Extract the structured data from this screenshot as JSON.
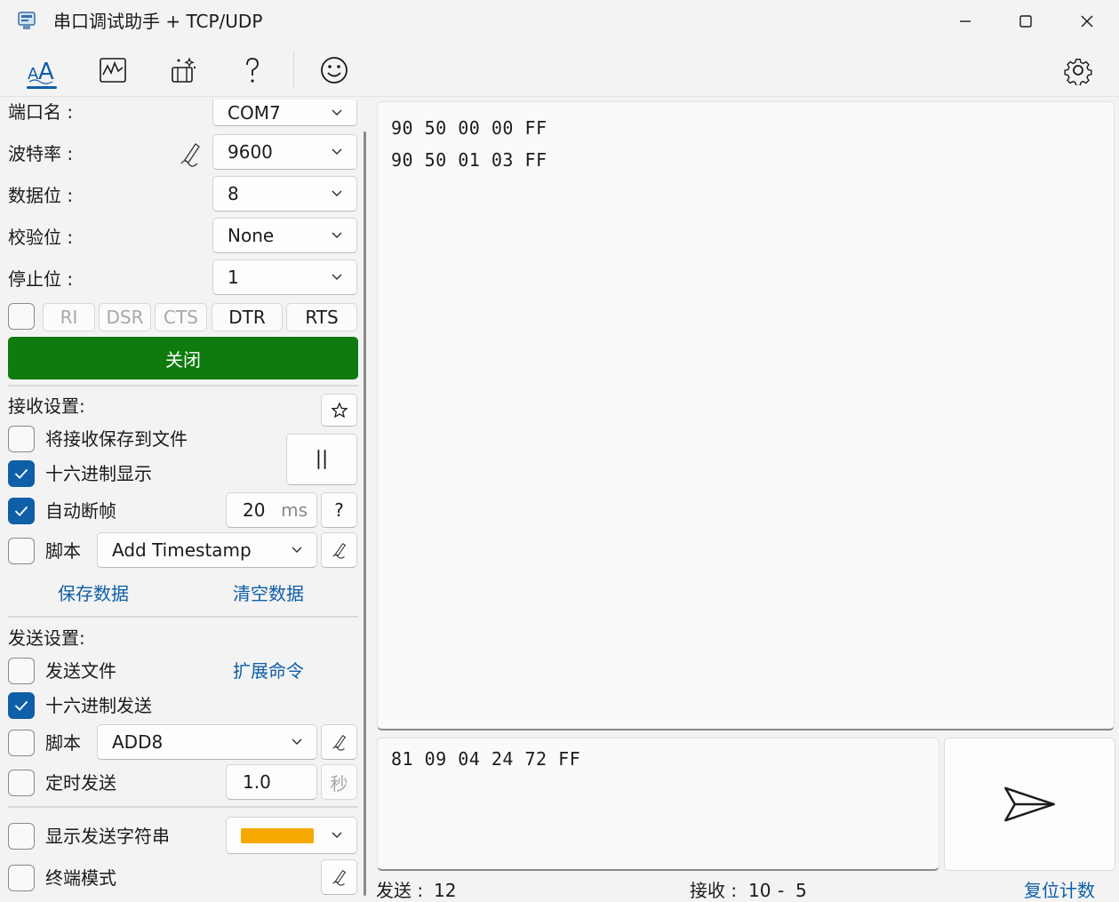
{
  "window": {
    "title": "串口调试助手 + TCP/UDP"
  },
  "toolbar": {
    "icons": [
      "text-format-icon",
      "waveform-icon",
      "magic-icon",
      "help-icon",
      "smiley-icon",
      "gear-icon"
    ]
  },
  "serial": {
    "port_label": "端口名 :",
    "port_value": "COM7",
    "baud_label": "波特率 :",
    "baud_value": "9600",
    "databits_label": "数据位 :",
    "databits_value": "8",
    "parity_label": "校验位 :",
    "parity_value": "None",
    "stopbits_label": "停止位 :",
    "stopbits_value": "1",
    "signals": {
      "ri": "RI",
      "dsr": "DSR",
      "cts": "CTS",
      "dtr": "DTR",
      "rts": "RTS"
    },
    "close_label": "关闭",
    "close_color": "#0f7b0f"
  },
  "receive": {
    "section_label": "接收设置:",
    "save_to_file": "将接收保存到文件",
    "hex_display": "十六进制显示",
    "auto_frame": "自动断帧",
    "frame_value": "20",
    "frame_unit": "ms",
    "help": "?",
    "script_label": "脚本",
    "script_value": "Add Timestamp",
    "save_data": "保存数据",
    "clear_data": "清空数据"
  },
  "send": {
    "section_label": "发送设置:",
    "send_file": "发送文件",
    "extend_cmd": "扩展命令",
    "hex_send": "十六进制发送",
    "script_label": "脚本",
    "script_value": "ADD8",
    "timed_send": "定时发送",
    "timed_value": "1.0",
    "timed_unit": "秒",
    "show_string": "显示发送字符串",
    "show_color": "#f5a800",
    "terminal_mode": "终端模式"
  },
  "recv_lines": [
    "90 50 00 00 FF",
    "90 50 01 03 FF"
  ],
  "send_text": "81 09 04 24 72 FF",
  "status": {
    "sent_label": "发送 :",
    "sent_value": "12",
    "recv_label": "接收 :",
    "recv_value": "10",
    "recv_sep": "-",
    "recv_value2": "5",
    "reset": "复位计数"
  }
}
